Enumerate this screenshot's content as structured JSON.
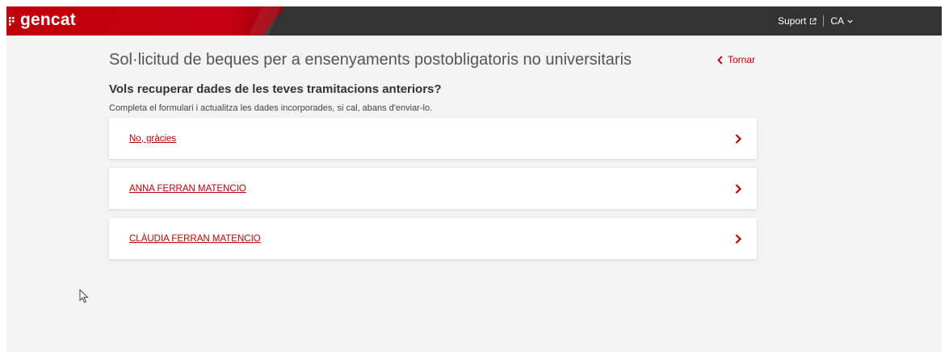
{
  "header": {
    "logo_text": "gencat",
    "support_label": "Suport",
    "language_label": "CA",
    "brand_color": "#c0000b",
    "bar_color": "#333333"
  },
  "main": {
    "title": "Sol·licitud de beques per a ensenyaments postobligatoris no universitaris",
    "back_label": "Tornar",
    "question": "Vols recuperar dades de les teves tramitacions anteriors?",
    "subtitle": "Completa el formulari i actualitza les dades incorporades, si cal, abans d'enviar-lo.",
    "options": [
      {
        "label": "No, gràcies"
      },
      {
        "label": "ANNA FERRAN MATENCIO"
      },
      {
        "label": "CLÀUDIA FERRAN MATENCIO"
      }
    ],
    "accent_color": "#c00000"
  },
  "icons": {
    "external": "external-link-icon",
    "lang": "chevron-down-icon",
    "back": "chevron-left-icon",
    "option": "chevron-right-icon",
    "cursor": "mouse-pointer-icon"
  }
}
